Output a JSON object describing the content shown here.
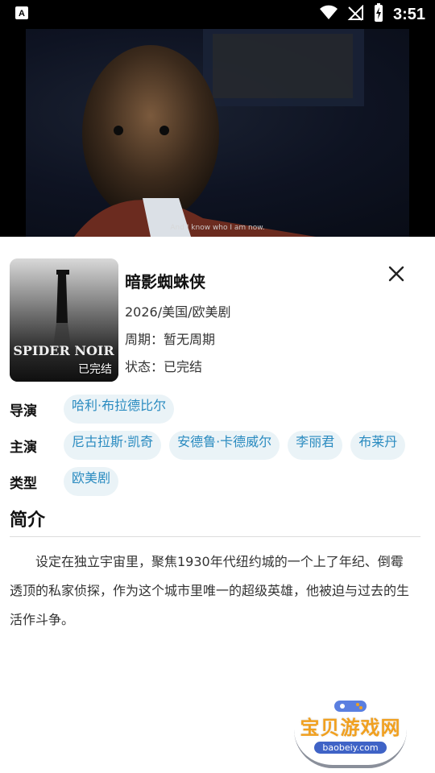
{
  "status_bar": {
    "time": "3:51",
    "left_icon": "font-a-icon",
    "icons": [
      "wifi-icon",
      "signal-off-icon",
      "battery-charging-icon"
    ]
  },
  "video": {
    "subtitle": "And I know who I am now."
  },
  "detail": {
    "title": "暗影蜘蛛侠",
    "year_region": "2026/美国/欧美剧",
    "period": "周期：暂无周期",
    "status": "状态：已完结",
    "poster_badge": "已完结",
    "poster_text": "SPIDER NOIR"
  },
  "credits": {
    "director_label": "导演",
    "directors": [
      "哈利·布拉德比尔"
    ],
    "cast_label": "主演",
    "cast": [
      "尼古拉斯·凯奇",
      "安德鲁·卡德威尔",
      "李丽君",
      "布莱丹"
    ],
    "genre_label": "类型",
    "genres": [
      "欧美剧"
    ]
  },
  "intro": {
    "title": "简介",
    "text": "设定在独立宇宙里，聚焦1930年代纽约城的一个上了年纪、倒霉透顶的私家侦探，作为这个城市里唯一的超级英雄，他被迫与过去的生活作斗争。"
  },
  "watermark": {
    "title": "宝贝游戏网",
    "site": "baobeiy.com"
  },
  "colors": {
    "chip_bg": "#eaf3f7",
    "chip_text": "#2a8bc0",
    "status_bg": "#000000"
  }
}
